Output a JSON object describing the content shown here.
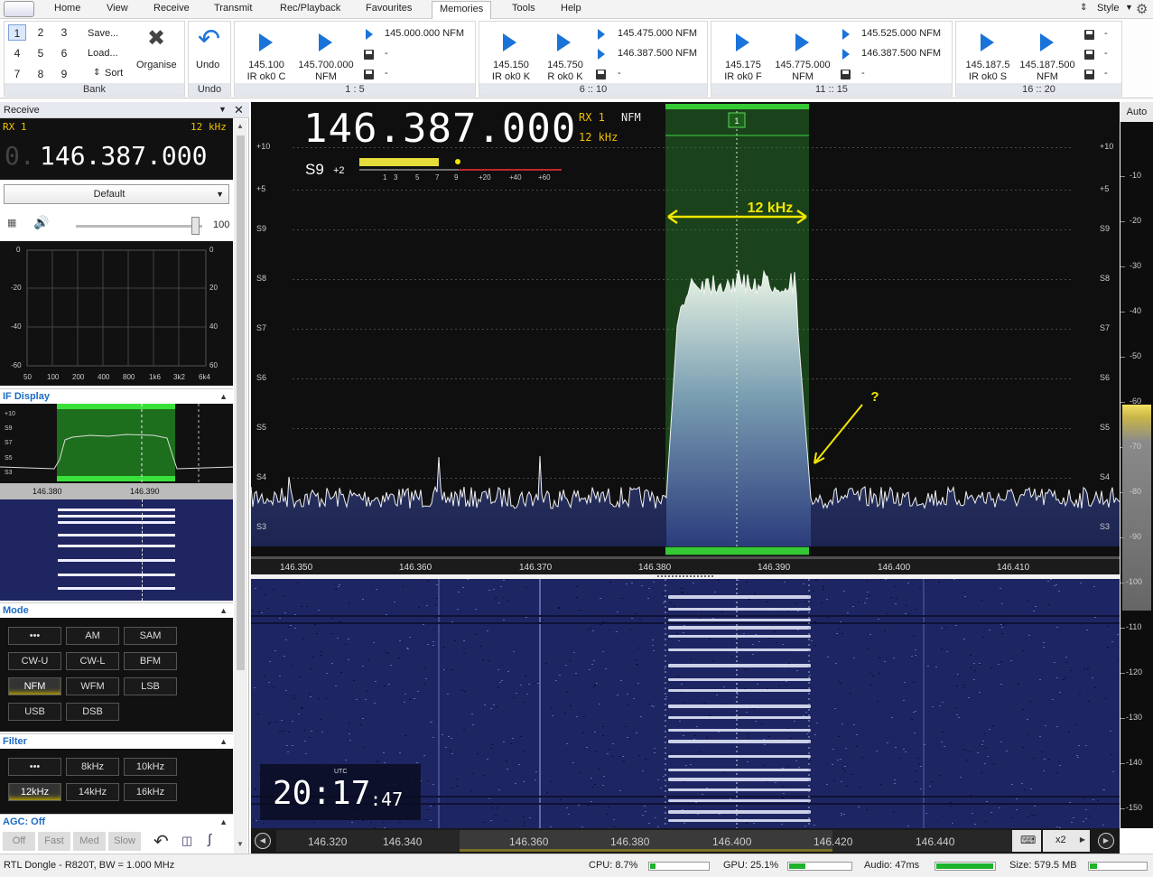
{
  "tabs": [
    "Home",
    "View",
    "Receive",
    "Transmit",
    "Rec/Playback",
    "Favourites",
    "Memories",
    "Tools",
    "Help"
  ],
  "active_tab": "Memories",
  "style_label": "Style",
  "bank": {
    "numbers": [
      "1",
      "2",
      "3",
      "4",
      "5",
      "6",
      "7",
      "8",
      "9"
    ],
    "save": "Save...",
    "load": "Load...",
    "sort": "Sort",
    "organise": "Organise",
    "caption": "Bank"
  },
  "undo": {
    "label": "Undo",
    "caption": "Undo"
  },
  "mem_groups": [
    {
      "caption": "1 : 5",
      "big": [
        {
          "freq": "145.100",
          "sub": "IR ok0 C"
        },
        {
          "freq": "145.700.000",
          "sub": "NFM"
        }
      ],
      "small": [
        "145.000.000 NFM",
        "-",
        "-"
      ]
    },
    {
      "caption": "6 :: 10",
      "big": [
        {
          "freq": "145.150",
          "sub": "IR ok0 K"
        },
        {
          "freq": "145.750",
          "sub": "R ok0 K"
        }
      ],
      "small": [
        "145.475.000 NFM",
        "146.387.500 NFM",
        "-"
      ]
    },
    {
      "caption": "11 :: 15",
      "big": [
        {
          "freq": "145.175",
          "sub": "IR ok0 F"
        },
        {
          "freq": "145.775.000",
          "sub": "NFM"
        }
      ],
      "small": [
        "145.525.000 NFM",
        "146.387.500 NFM",
        "-"
      ]
    },
    {
      "caption": "16 :: 20",
      "big": [
        {
          "freq": "145.187.5",
          "sub": "IR ok0 S"
        },
        {
          "freq": "145.187.500",
          "sub": "NFM"
        }
      ],
      "small": [
        "-",
        "-",
        "-"
      ]
    }
  ],
  "receive": {
    "title": "Receive",
    "rx": "RX 1",
    "bw": "12",
    "bw_unit": "kHz",
    "freq_dim": "0.",
    "freq": "146.387.000",
    "preset": "Default",
    "volume": "100"
  },
  "audio_spec": {
    "left": [
      "0",
      "-20",
      "-40",
      "-60"
    ],
    "right": [
      "0",
      "20",
      "40",
      "60"
    ],
    "bottom": [
      "50",
      "100",
      "200",
      "400",
      "800",
      "1k6",
      "3k2",
      "6k4"
    ]
  },
  "if_display": {
    "title": "IF Display",
    "labels": [
      "+10",
      "S9",
      "S7",
      "S5",
      "S3"
    ],
    "freqs": [
      "146.380",
      "146.390"
    ]
  },
  "mode": {
    "title": "Mode",
    "buttons": [
      "•••",
      "AM",
      "SAM",
      "CW-U",
      "CW-L",
      "BFM",
      "NFM",
      "WFM",
      "LSB",
      "USB",
      "DSB"
    ],
    "active": "NFM"
  },
  "filter": {
    "title": "Filter",
    "buttons": [
      "•••",
      "8kHz",
      "10kHz",
      "12kHz",
      "14kHz",
      "16kHz"
    ],
    "active": "12kHz"
  },
  "agc": {
    "title": "AGC: Off",
    "buttons": [
      "Off",
      "Fast",
      "Med",
      "Slow"
    ]
  },
  "spectrum": {
    "freq": "146.387.000",
    "rx": "RX 1",
    "mode": "NFM",
    "bw": "12 kHz",
    "smeter": "S9",
    "smeter_plus": "+2",
    "smeter_scale": [
      "1",
      "3",
      "5",
      "7",
      "9",
      "+20",
      "+40",
      "+60"
    ],
    "levels": [
      "+10",
      "+5",
      "S9",
      "S8",
      "S7",
      "S6",
      "S5",
      "S4",
      "S3"
    ],
    "freq_axis": [
      "146.350",
      "146.360",
      "146.370",
      "146.380",
      "146.390",
      "146.400",
      "146.410"
    ],
    "bw_annot": "12 kHz",
    "question": "?",
    "channel": "1"
  },
  "right_scale": {
    "auto": "Auto",
    "labels": [
      "-10",
      "-20",
      "-30",
      "-40",
      "-50",
      "-60",
      "-70",
      "-80",
      "-90",
      "-100",
      "-110",
      "-120",
      "-130",
      "-140",
      "-150"
    ]
  },
  "waterfall": {
    "clock_hm": "20:17",
    "clock_s": ":47",
    "utc": "UTC",
    "axis": [
      "146.320",
      "146.340",
      "146.360",
      "146.380",
      "146.400",
      "146.420",
      "146.440"
    ],
    "zoom": "x2"
  },
  "status": {
    "device": "RTL Dongle - R820T, BW = 1.000 MHz",
    "cpu": "CPU: 8.7%",
    "gpu": "GPU: 25.1%",
    "audio": "Audio: 47ms",
    "size": "Size: 579.5 MB",
    "cpu_level": 0.09,
    "gpu_level": 0.25,
    "audio_level": 0.95,
    "size_level": 0.12
  },
  "colors": {
    "accent": "#1c6bc4",
    "passband": "#2db52d",
    "annot": "#f2e600"
  }
}
